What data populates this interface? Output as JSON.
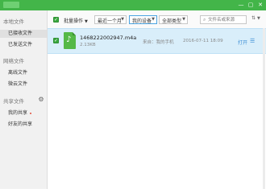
{
  "window": {
    "minimize": "—",
    "maximize": "▢",
    "close": "✕"
  },
  "sidebar": {
    "local_title": "本地文件",
    "received": "已接收文件",
    "sent": "已发送文件",
    "network_title": "网络文件",
    "offline": "离线文件",
    "weiyun": "微云文件",
    "share_title": "共享文件",
    "my_share": "我的共享",
    "friend_share": "好友的共享"
  },
  "toolbar": {
    "batch": "批量操作",
    "period": "最近一个月",
    "device": "我的设备",
    "type": "全部类型",
    "search_placeholder": "文件名或来源"
  },
  "files": [
    {
      "name": "1468222002947.m4a",
      "size": "2.13KB",
      "source": "来自：我的手机",
      "time": "2016-07-11 18:09",
      "open": "打开"
    }
  ]
}
